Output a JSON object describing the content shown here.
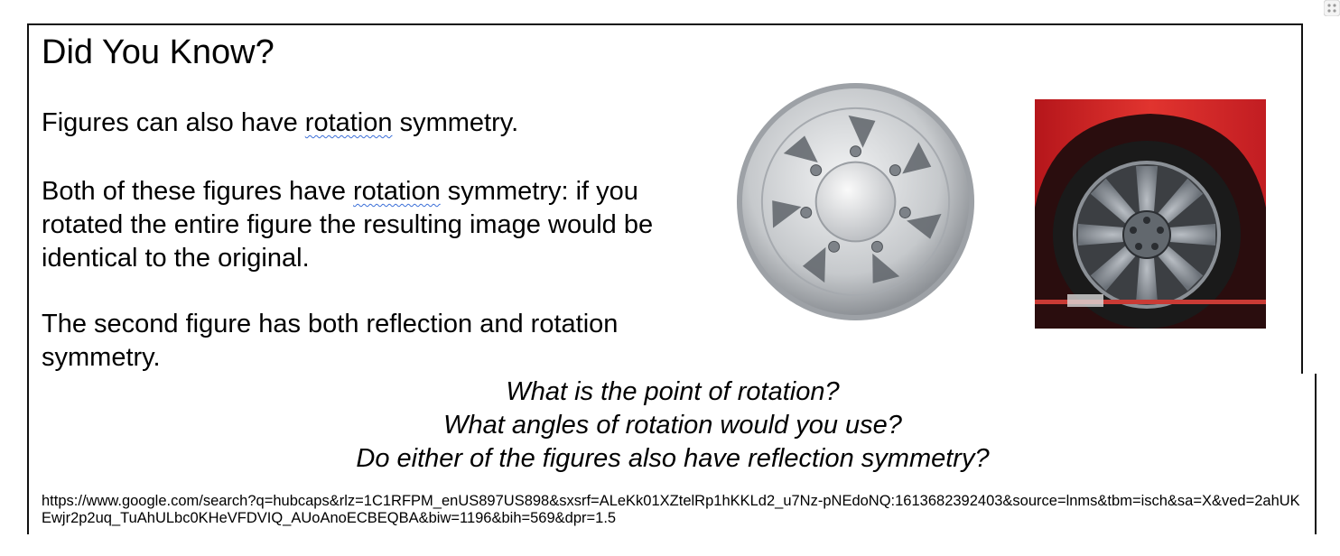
{
  "slide": {
    "title": "Did You Know?",
    "paragraphs": {
      "p1": {
        "before": "Figures can also have ",
        "underlined": "rotation",
        "after": " symmetry."
      },
      "p2": {
        "before": "Both of these figures have ",
        "underlined": "rotation",
        "after": " symmetry: if you rotated the entire figure the resulting image would be identical to the original."
      },
      "p3": "The second figure has both reflection and rotation symmetry."
    },
    "questions": [
      "What is the point of rotation?",
      "What angles of rotation would you use?",
      "Do either of the figures also have reflection symmetry?"
    ],
    "url": "https://www.google.com/search?q=hubcaps&rlz=1C1RFPM_enUS897US898&sxsrf=ALeKk01XZtelRp1hKKLd2_u7Nz-pNEdoNQ:1613682392403&source=lnms&tbm=isch&sa=X&ved=2ahUKEwjr2p2uq_TuAhULbc0KHeVFDVIQ_AUoAnoECBEQBA&biw=1196&bih=569&dpr=1.5"
  },
  "images": [
    {
      "icon": "hubcap-image",
      "spokes": 7,
      "lug_nuts": 7
    },
    {
      "icon": "car-wheel-image",
      "spokes": 8,
      "lug_nuts": 5
    }
  ],
  "colors": {
    "wavy_underline": "#3b6fd8",
    "car_red": "#d8262a",
    "tire_black": "#1a1a1a",
    "rim_gray": "#7f858c"
  }
}
